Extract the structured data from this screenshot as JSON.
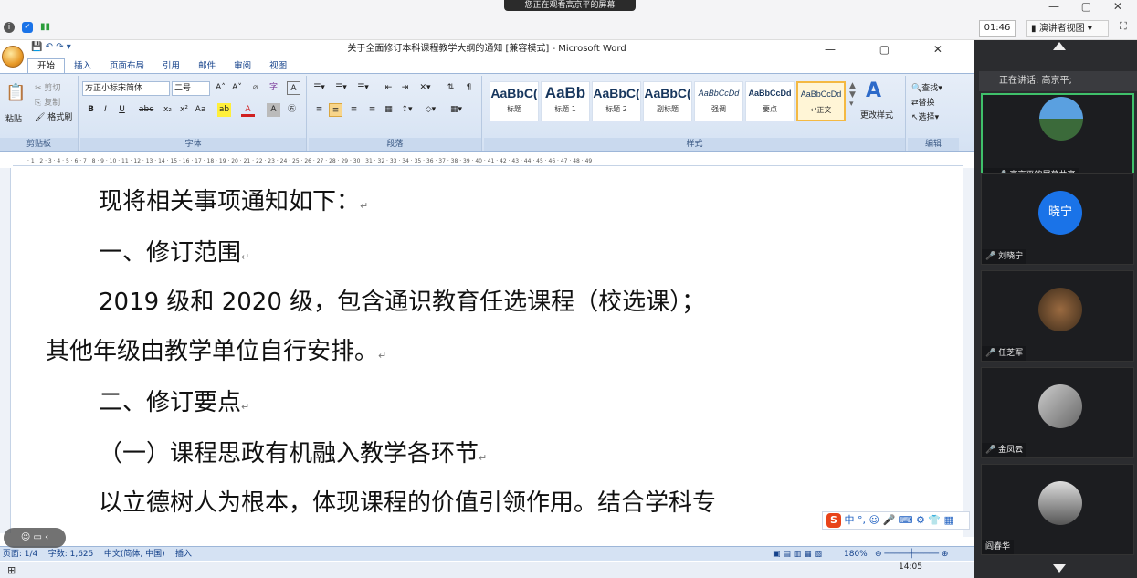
{
  "conference": {
    "share_banner": "您正在观看高京平的屏幕",
    "timer": "01:46",
    "presenter_view": "演讲者视图",
    "speaking": "正在讲话: 高京平;",
    "participants": [
      {
        "name": "高京平的屏幕共享",
        "initial": ""
      },
      {
        "name": "刘晓宁",
        "initial": "晓宁"
      },
      {
        "name": "任芝军",
        "initial": ""
      },
      {
        "name": "金凤云",
        "initial": ""
      },
      {
        "name": "阎春华",
        "initial": ""
      }
    ],
    "colors": {
      "active_border": "#3fc06a",
      "initial_avatar": "#1a73e8"
    }
  },
  "word": {
    "title": "关于全面修订本科课程教学大纲的通知 [兼容模式] - Microsoft Word",
    "tabs": [
      "开始",
      "插入",
      "页面布局",
      "引用",
      "邮件",
      "审阅",
      "视图"
    ],
    "active_tab": "开始",
    "clipboard": {
      "paste": "粘贴",
      "cut": "剪切",
      "copy": "复制",
      "format_painter": "格式刷",
      "label": "剪贴板"
    },
    "font": {
      "name": "方正小标宋简体",
      "size": "二号",
      "label": "字体"
    },
    "paragraph_label": "段落",
    "styles": {
      "label": "样式",
      "items": [
        {
          "preview": "AaBbC(",
          "name": "标题"
        },
        {
          "preview": "AaBb",
          "name": "标题 1"
        },
        {
          "preview": "AaBbC(",
          "name": "标题 2"
        },
        {
          "preview": "AaBbC(",
          "name": "副标题"
        },
        {
          "preview": "AaBbCcDd",
          "name": "强调"
        },
        {
          "preview": "AaBbCcDd",
          "name": "要点"
        },
        {
          "preview": "AaBbCcDd",
          "name": "↵正文"
        }
      ],
      "change_styles": "更改样式"
    },
    "editing": {
      "find": "查找",
      "replace": "替换",
      "select": "选择",
      "label": "编辑"
    },
    "document_lines": [
      "现将相关事项通知如下：",
      "一、修订范围",
      "2019 级和 2020 级，包含通识教育任选课程（校选课）；",
      "其他年级由教学单位自行安排。",
      "二、修订要点",
      "（一）课程思政有机融入教学各环节",
      "以立德树人为根本，体现课程的价值引领作用。结合学科专"
    ],
    "status": {
      "page": "页面: 1/4",
      "words": "字数: 1,625",
      "language": "中文(简体, 中国)",
      "mode": "插入",
      "zoom": "180%"
    },
    "ime": "中"
  },
  "taskbar": {
    "clock": "14:05"
  }
}
